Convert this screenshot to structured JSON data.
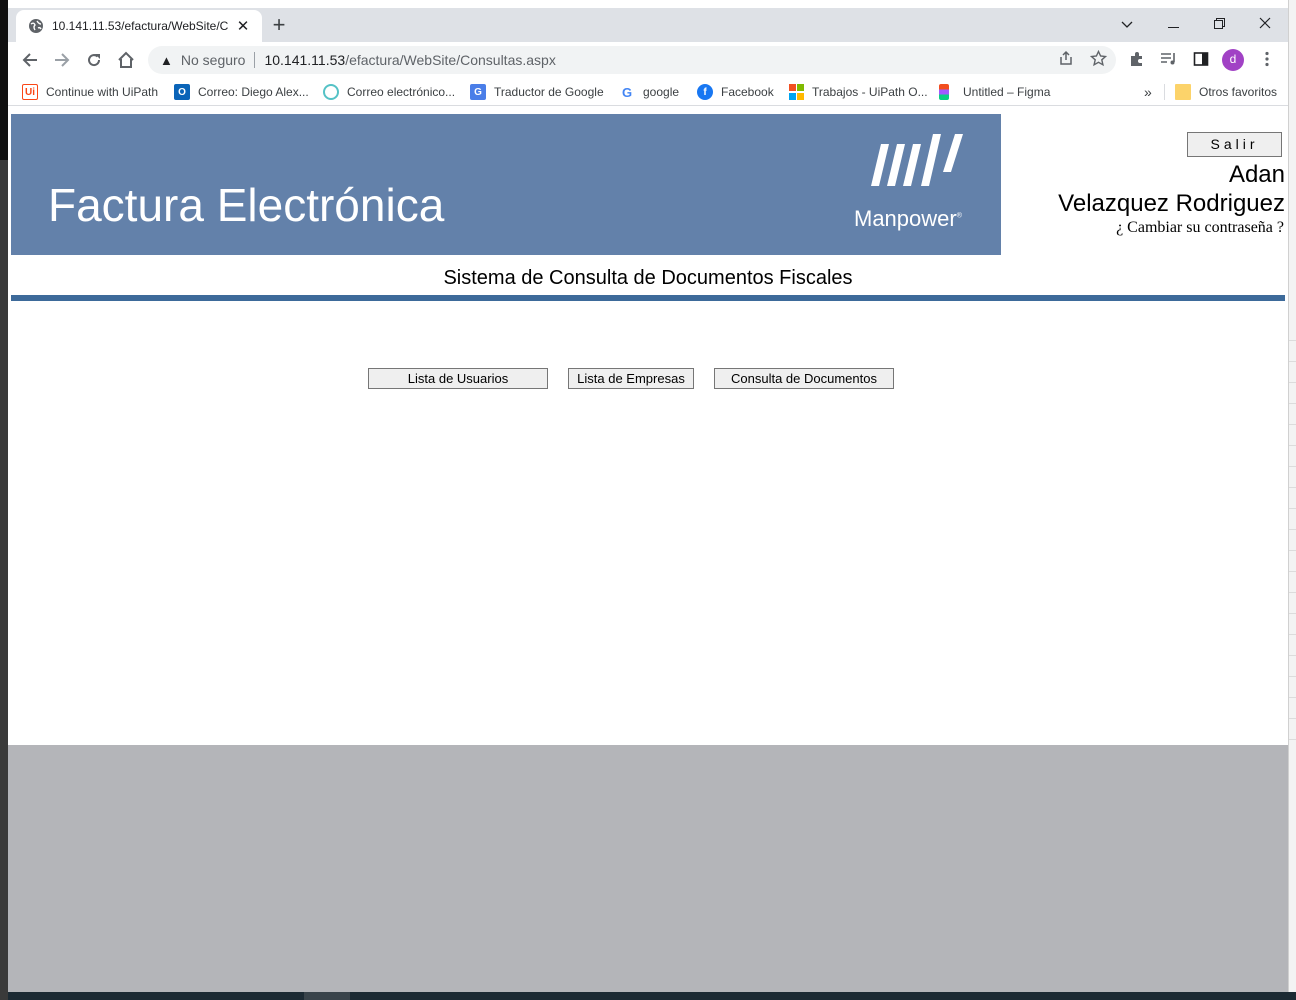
{
  "browser": {
    "tab_title": "10.141.11.53/efactura/WebSite/C",
    "new_tab": "+",
    "security_label": "No seguro",
    "url_host": "10.141.11.53",
    "url_path": "/efactura/WebSite/Consultas.aspx",
    "profile_initial": "d",
    "bookmarks": [
      "Continue with UiPath",
      "Correo: Diego Alex...",
      "Correo electrónico...",
      "Traductor de Google",
      "google",
      "Facebook",
      "Trabajos - UiPath O...",
      "Untitled – Figma"
    ],
    "bookmarks_more": "»",
    "other_bookmarks": "Otros favoritos"
  },
  "page": {
    "banner_title": "Factura Electrónica",
    "logo_text": "Manpower",
    "logo_mark": "®",
    "logout_label": "Salir",
    "user_first": "Adan",
    "user_last": "Velazquez Rodriguez",
    "change_password": "¿ Cambiar su contraseña ?",
    "subtitle": "Sistema de Consulta de Documentos Fiscales",
    "buttons": [
      "Lista de Usuarios",
      "Lista de Empresas",
      "Consulta de Documentos"
    ]
  },
  "colors": {
    "banner": "#6381aa",
    "rule": "#3d6a9a",
    "lower_area": "#b4b5b9"
  }
}
